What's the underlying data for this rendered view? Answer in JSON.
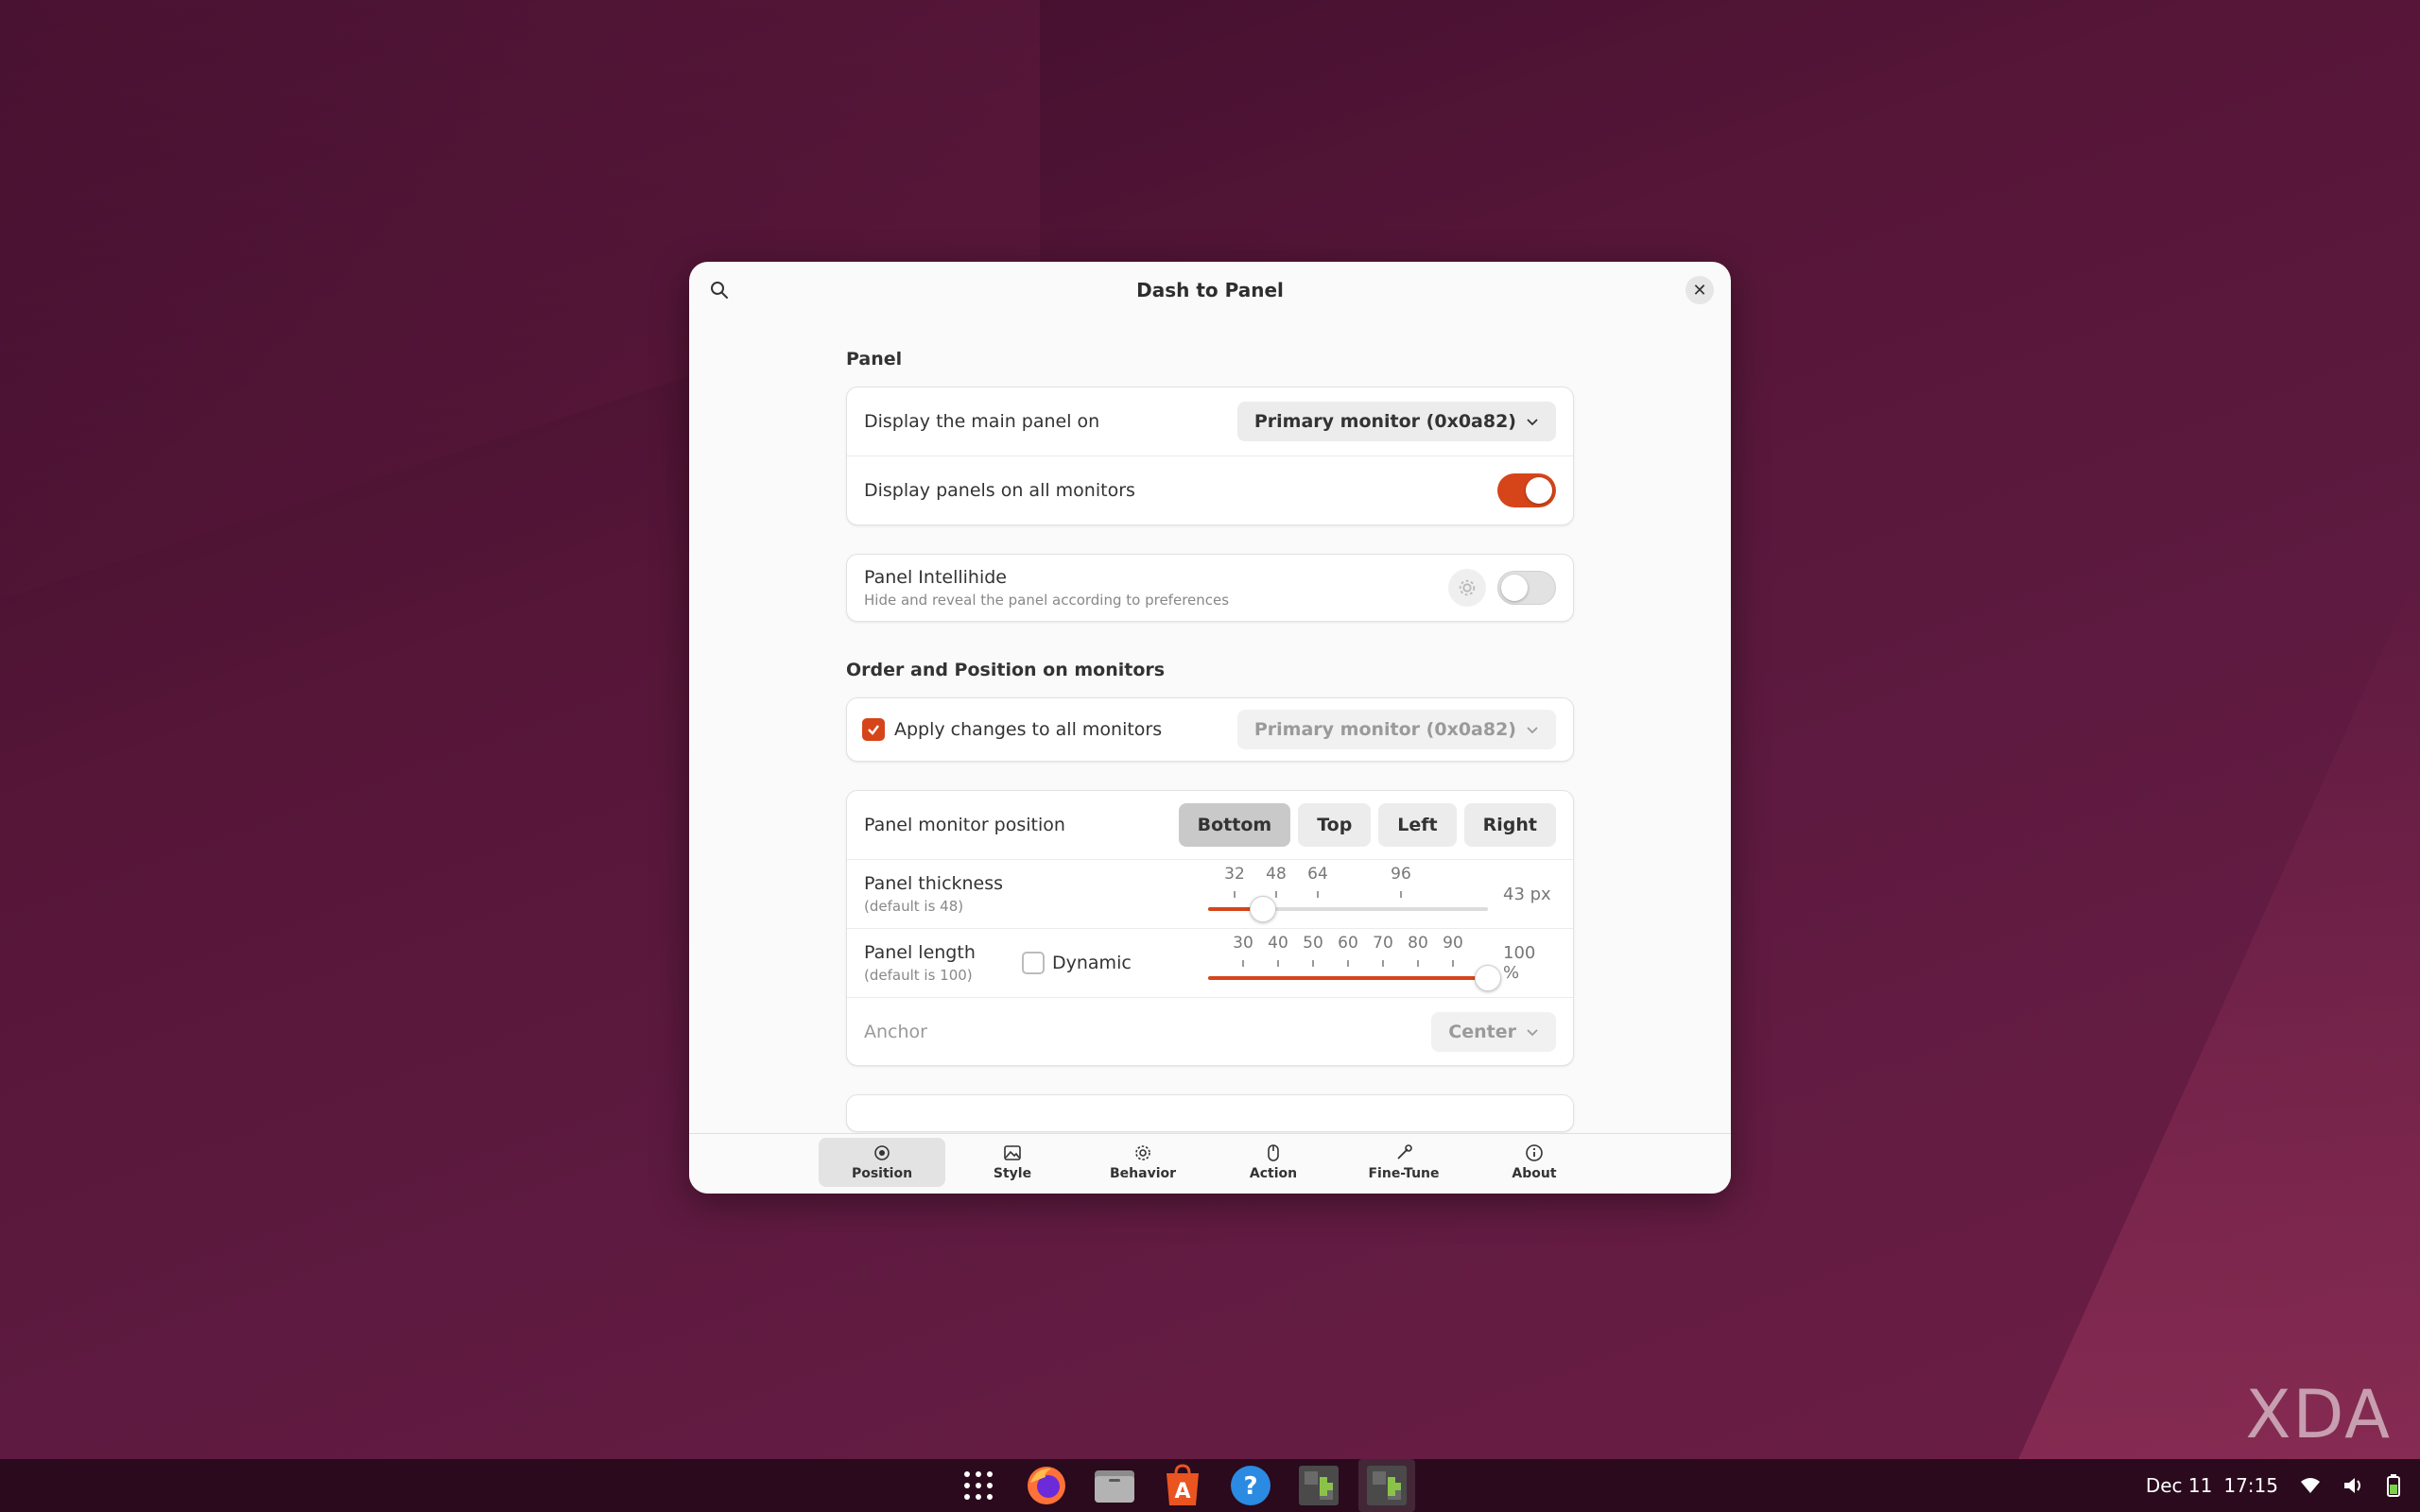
{
  "window": {
    "title": "Dash to Panel"
  },
  "panel_section": {
    "title": "Panel",
    "display_main_label": "Display the main panel on",
    "display_main_value": "Primary monitor (0x0a82)",
    "display_all_label": "Display panels on all monitors",
    "display_all_on": true
  },
  "intellihide": {
    "title": "Panel Intellihide",
    "subtitle": "Hide and reveal the panel according to preferences",
    "enabled": false
  },
  "order_section": {
    "title": "Order and Position on monitors",
    "apply_all_label": "Apply changes to all monitors",
    "apply_all_checked": true,
    "monitor_value": "Primary monitor (0x0a82)"
  },
  "position": {
    "label": "Panel monitor position",
    "options": [
      "Bottom",
      "Top",
      "Left",
      "Right"
    ],
    "selected": "Bottom"
  },
  "thickness": {
    "label": "Panel thickness",
    "default_text": "(default is 48)",
    "ticks": [
      "32",
      "48",
      "64",
      "96"
    ],
    "value_text": "43 px",
    "value": 43
  },
  "length": {
    "label": "Panel length",
    "default_text": "(default is 100)",
    "dynamic_label": "Dynamic",
    "dynamic_checked": false,
    "ticks": [
      "30",
      "40",
      "50",
      "60",
      "70",
      "80",
      "90"
    ],
    "value_text": "100 %",
    "value": 100
  },
  "anchor": {
    "label": "Anchor",
    "value": "Center"
  },
  "nav": {
    "items": [
      "Position",
      "Style",
      "Behavior",
      "Action",
      "Fine-Tune",
      "About"
    ],
    "active": "Position"
  },
  "taskbar": {
    "date": "Dec 11",
    "time": "17:15"
  },
  "watermark": "XDA",
  "colors": {
    "accent": "#d6451a"
  }
}
